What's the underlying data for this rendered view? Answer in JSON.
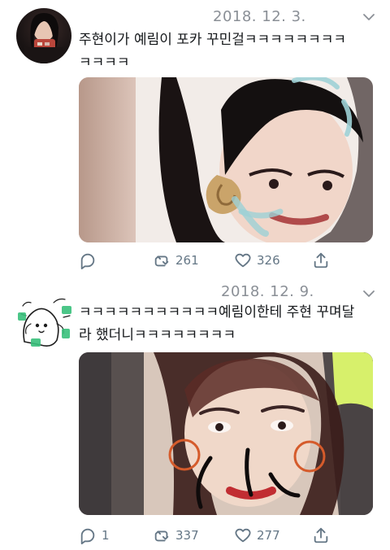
{
  "tweets": [
    {
      "date": "2018. 12. 3.",
      "text": "주현이가 예림이 포카 꾸민걸ㅋㅋㅋㅋㅋㅋㅋㅋ\nㅋㅋㅋㅋ",
      "reply_count": "",
      "retweet_count": "261",
      "like_count": "326",
      "icons": {
        "menu": "chevron-down-icon",
        "reply": "reply-icon",
        "retweet": "retweet-icon",
        "like": "heart-icon",
        "share": "share-icon"
      }
    },
    {
      "date": "2018. 12. 9.",
      "text": "ㅋㅋㅋㅋㅋㅋㅋㅋㅋㅋㅋ예림이한테 주현 꾸며달\n라 했더니ㅋㅋㅋㅋㅋㅋㅋㅋ",
      "reply_count": "1",
      "retweet_count": "337",
      "like_count": "277",
      "icons": {
        "menu": "chevron-down-icon",
        "reply": "reply-icon",
        "retweet": "retweet-icon",
        "like": "heart-icon",
        "share": "share-icon"
      }
    }
  ],
  "colors": {
    "text": "#14171a",
    "muted": "#657786",
    "date": "#8a8f96"
  }
}
